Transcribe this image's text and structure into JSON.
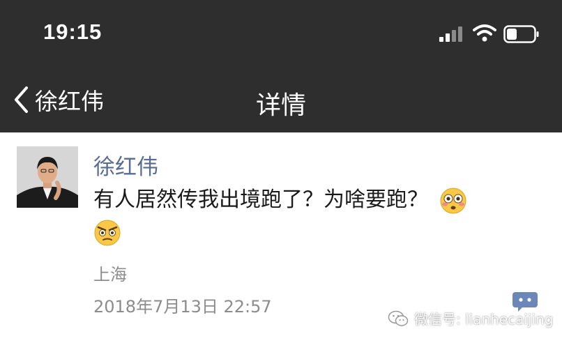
{
  "status_bar": {
    "time": "19:15",
    "icons": [
      "signal-icon",
      "wifi-icon",
      "battery-icon"
    ]
  },
  "nav": {
    "back_label": "徐红伟",
    "title": "详情"
  },
  "post": {
    "author": "徐红伟",
    "text": "有人居然传我出境跑了？为啥要跑？",
    "emojis": [
      "flushed-emoji",
      "angry-emoji"
    ],
    "location": "上海",
    "timestamp": "2018年7月13日 22:57"
  },
  "watermark": {
    "text": "微信号: lianhecaijing"
  },
  "colors": {
    "header_bg": "#2e2e2e",
    "author_link": "#576b95",
    "meta_text": "#8c8c8c",
    "content_bg": "#ffffff",
    "comment_button": "#6b86b8"
  }
}
